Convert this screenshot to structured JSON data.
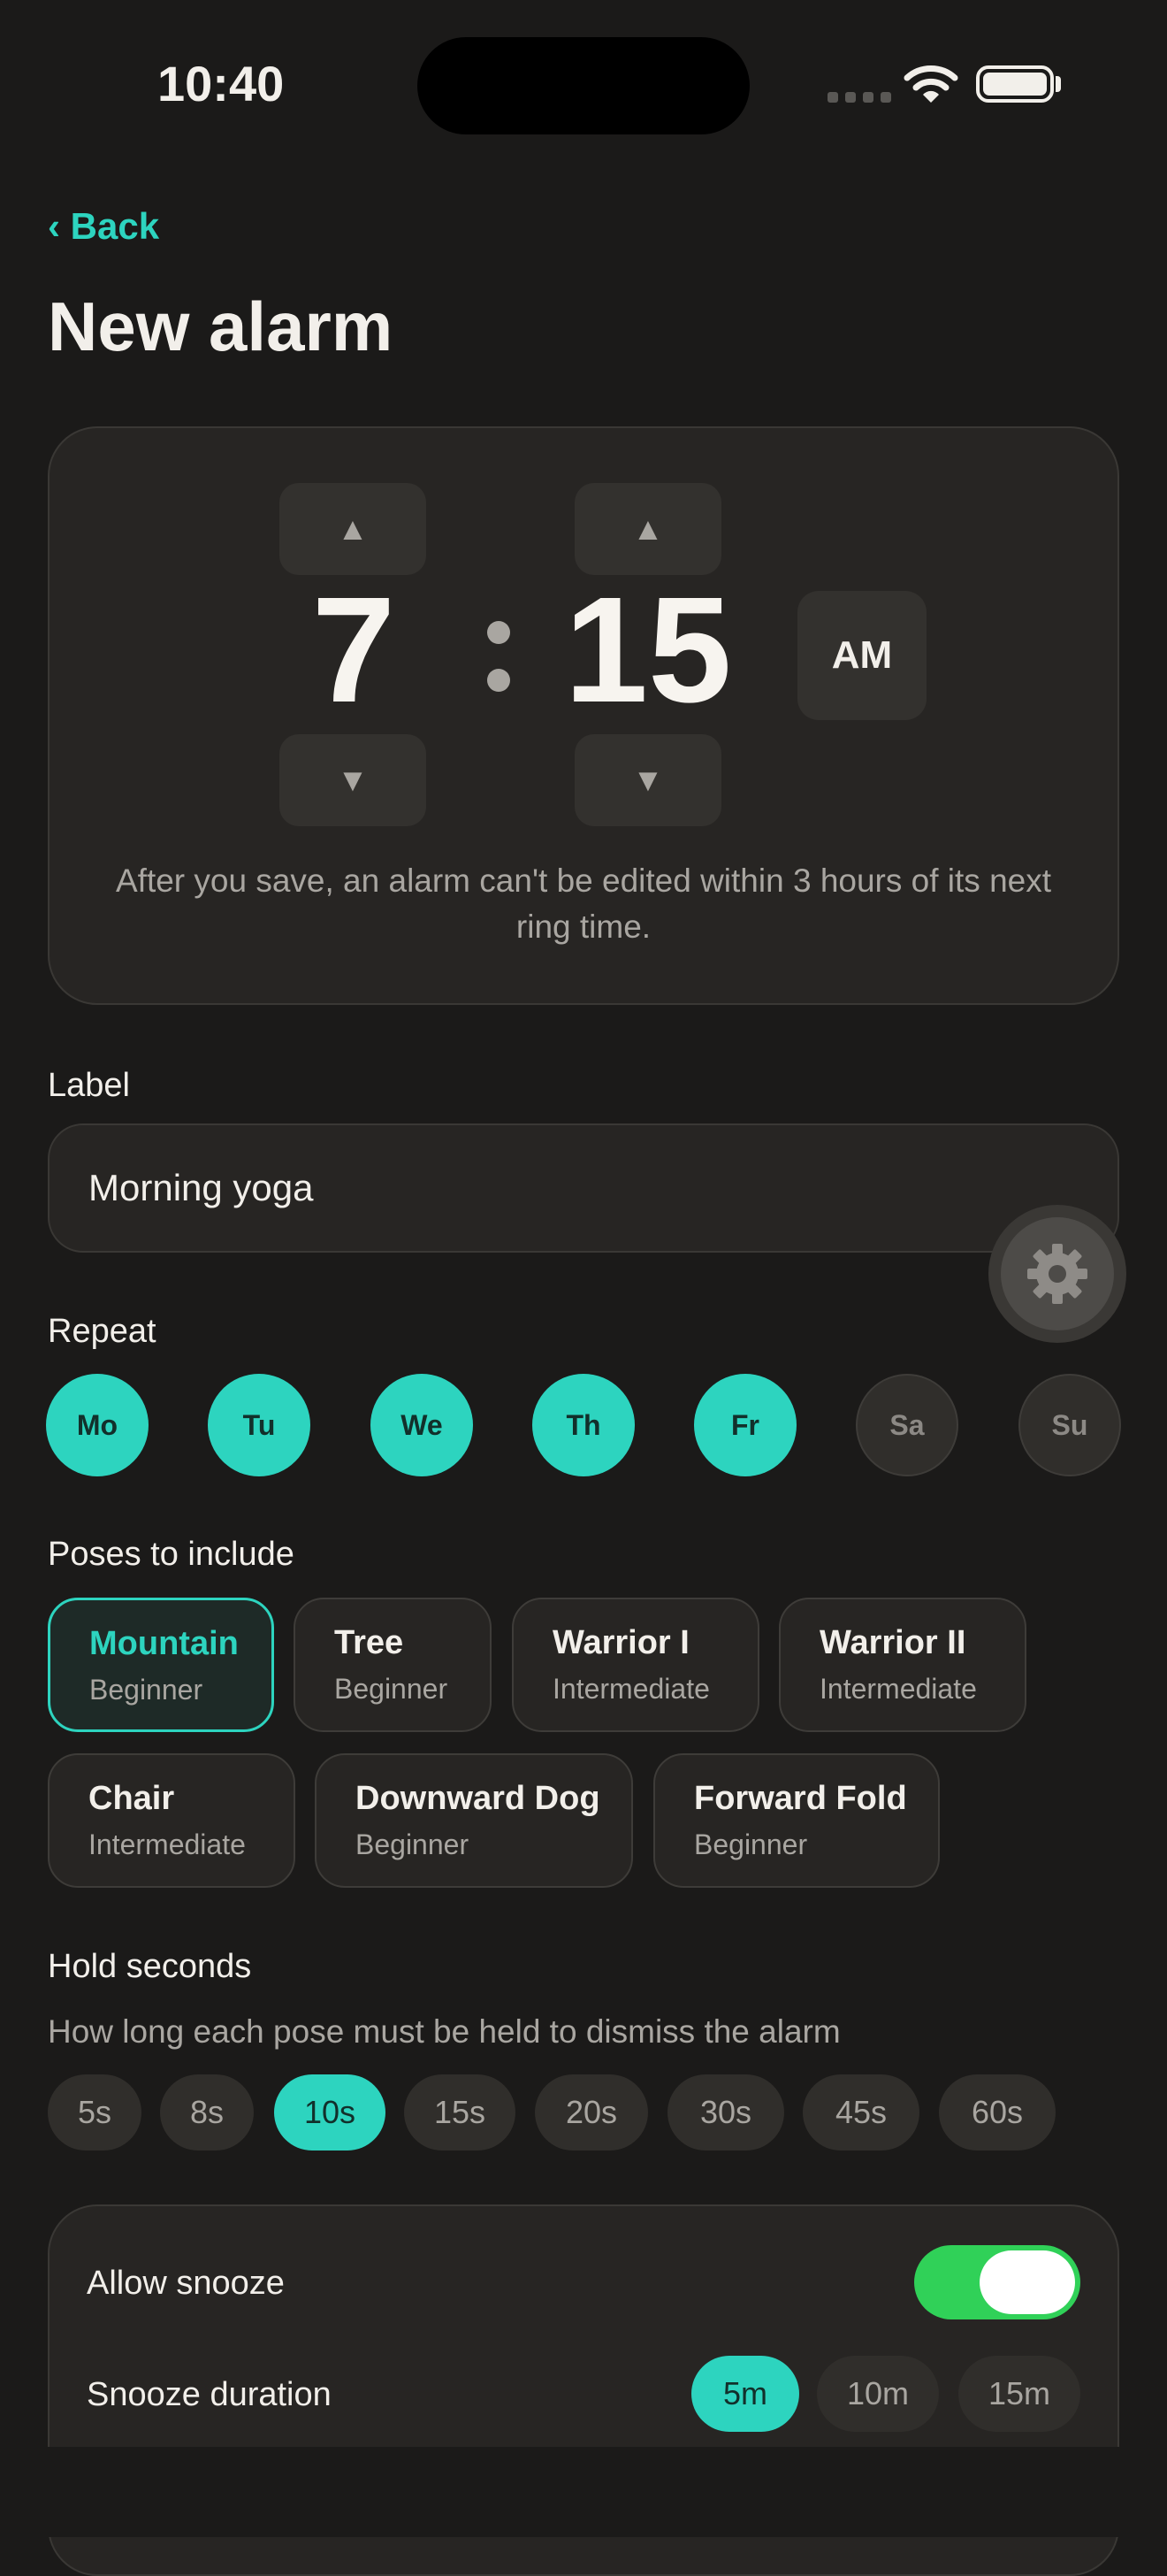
{
  "status_bar": {
    "time": "10:40"
  },
  "nav": {
    "back_label": "‹ Back",
    "title": "New alarm"
  },
  "time_picker": {
    "hour": "7",
    "minute": "15",
    "meridiem": "AM",
    "up_glyph": "▲",
    "down_glyph": "▼",
    "note": "After you save, an alarm can't be edited within 3 hours of its next ring time."
  },
  "label_section": {
    "heading": "Label",
    "value": "Morning yoga"
  },
  "repeat": {
    "heading": "Repeat",
    "days": [
      {
        "label": "Mo",
        "selected": true
      },
      {
        "label": "Tu",
        "selected": true
      },
      {
        "label": "We",
        "selected": true
      },
      {
        "label": "Th",
        "selected": true
      },
      {
        "label": "Fr",
        "selected": true
      },
      {
        "label": "Sa",
        "selected": false
      },
      {
        "label": "Su",
        "selected": false
      }
    ]
  },
  "poses": {
    "heading": "Poses to include",
    "items": [
      {
        "name": "Mountain",
        "level": "Beginner",
        "selected": true
      },
      {
        "name": "Tree",
        "level": "Beginner",
        "selected": false
      },
      {
        "name": "Warrior I",
        "level": "Intermediate",
        "selected": false
      },
      {
        "name": "Warrior II",
        "level": "Intermediate",
        "selected": false
      },
      {
        "name": "Chair",
        "level": "Intermediate",
        "selected": false
      },
      {
        "name": "Downward Dog",
        "level": "Beginner",
        "selected": false
      },
      {
        "name": "Forward Fold",
        "level": "Beginner",
        "selected": false
      }
    ]
  },
  "hold": {
    "heading": "Hold seconds",
    "hint": "How long each pose must be held to dismiss the alarm",
    "options": [
      "5s",
      "8s",
      "10s",
      "15s",
      "20s",
      "30s",
      "45s",
      "60s"
    ],
    "selected": "10s"
  },
  "snooze": {
    "allow_label": "Allow snooze",
    "allow_enabled": true,
    "duration_label": "Snooze duration",
    "options": [
      "5m",
      "10m",
      "15m"
    ],
    "selected": "5m"
  },
  "icons": {
    "settings": "gear-icon",
    "wifi": "wifi-icon",
    "battery": "battery-icon"
  },
  "colors": {
    "accent": "#2dd4bf",
    "toggle_on": "#30d158",
    "background": "#1b1a19"
  }
}
